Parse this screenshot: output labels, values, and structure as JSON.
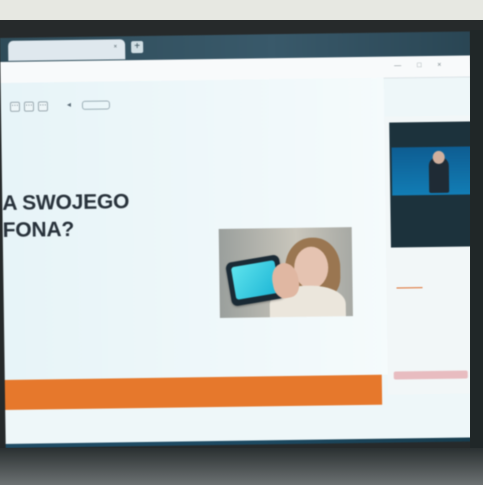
{
  "photo": {
    "subject": "monitor-display"
  },
  "browser": {
    "tab_title": "",
    "url_text": "",
    "new_tab_icon": "plus-icon"
  },
  "slide": {
    "title_lines": [
      "A SWOJEGO",
      "FONA?"
    ],
    "illustration": "child-with-phone-photo"
  },
  "sidebar": {
    "video_caption": "",
    "section_title": "",
    "tab_labels": [
      "",
      ""
    ],
    "notice_text": "",
    "input_placeholder": ""
  },
  "taskbar": {
    "clock": ""
  },
  "colors": {
    "accent_orange": "#e6782c",
    "slide_background": "#eef7f9",
    "taskbar": "#1c4961"
  }
}
